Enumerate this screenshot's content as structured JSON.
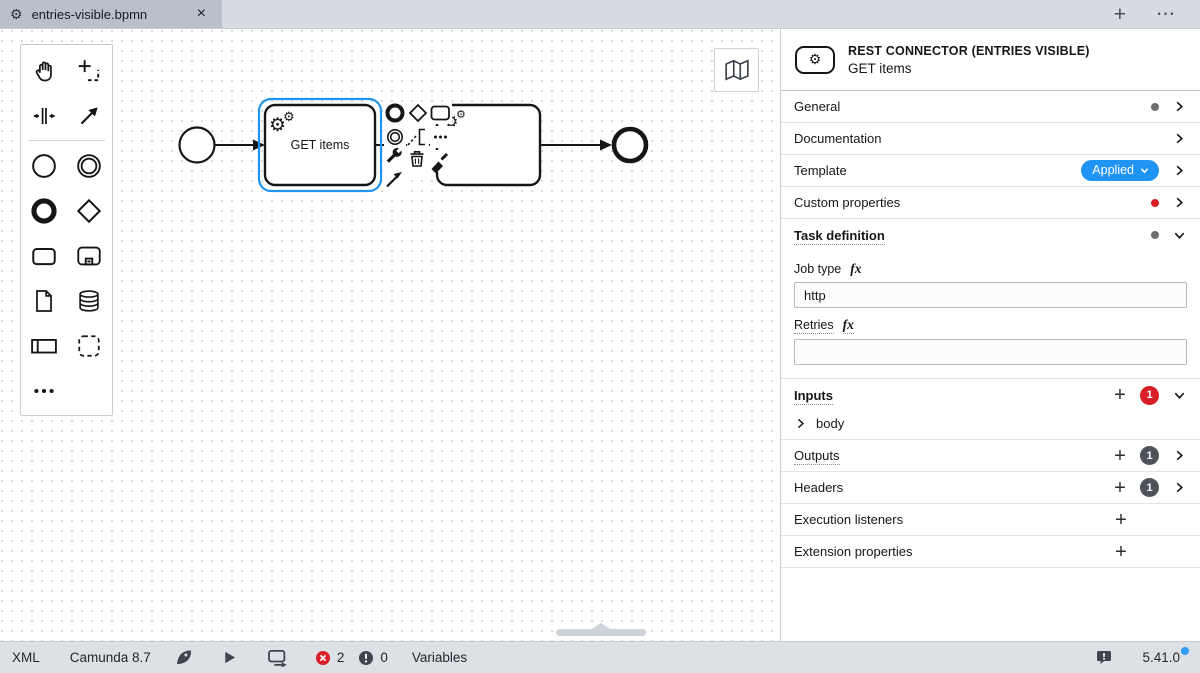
{
  "tab_bar": {
    "active_tab_title": "entries-visible.bpmn"
  },
  "icons": {
    "gear": "⚙",
    "close": "×",
    "plus": "+",
    "more": "⋯",
    "fx": "fx"
  },
  "diagram": {
    "task1_label": "GET items"
  },
  "panel": {
    "header_title": "REST CONNECTOR (ENTRIES VISIBLE)",
    "header_subtitle": "GET items",
    "general_label": "General",
    "documentation_label": "Documentation",
    "template_label": "Template",
    "template_badge": "Applied",
    "custom_properties_label": "Custom properties",
    "task_definition_label": "Task definition",
    "job_type_label": "Job type",
    "job_type_value": "http",
    "retries_label": "Retries",
    "retries_value": "",
    "inputs_label": "Inputs",
    "inputs_count": "1",
    "input_item_label": "body",
    "outputs_label": "Outputs",
    "outputs_count": "1",
    "headers_label": "Headers",
    "headers_count": "1",
    "execution_listeners_label": "Execution listeners",
    "extension_properties_label": "Extension properties"
  },
  "status_bar": {
    "xml_label": "XML",
    "engine_label": "Camunda 8.7",
    "error_count": "2",
    "warning_count": "0",
    "variables_label": "Variables",
    "version": "5.41.0"
  },
  "colors": {
    "selection_blue": "#2094f3",
    "template_pill_blue": "#1f94f4",
    "error_red": "#da1e28",
    "badge_gray": "#4d5358",
    "update_dot_blue": "#2e9cf5"
  }
}
